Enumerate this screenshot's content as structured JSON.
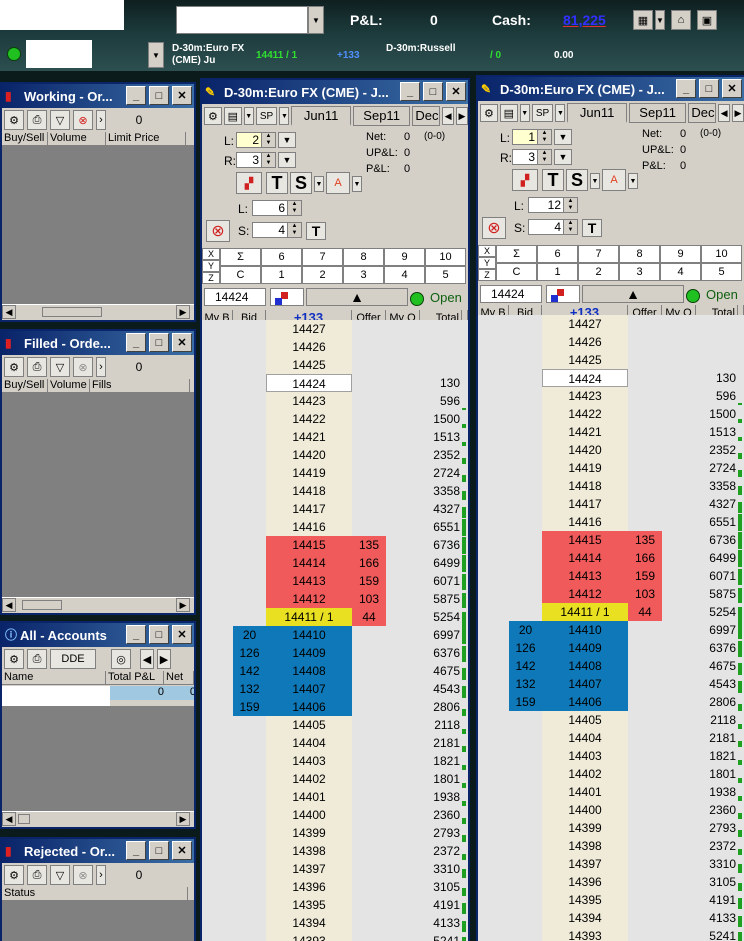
{
  "topbar": {
    "pnl_label": "P&L:",
    "pnl_value": "0",
    "cash_label": "Cash:",
    "cash_value": "81,225",
    "instrument1": "D-30m:Euro FX (CME) Ju",
    "instrument1_price": "14411 / 1",
    "instrument1_change": "+133",
    "instrument2": "D-30m:Russell",
    "instrument2_price": "/ 0",
    "instrument2_value": "0.00"
  },
  "working": {
    "title": "Working - Or...",
    "count": "0",
    "headers": [
      "Buy/Sell",
      "Volume",
      "Limit Price"
    ]
  },
  "filled": {
    "title": "Filled - Orde...",
    "count": "0",
    "headers": [
      "Buy/Sell",
      "Volume",
      "Fills"
    ]
  },
  "accounts": {
    "title": "All - Accounts",
    "dde": "DDE",
    "headers": [
      "Name",
      "Total P&L",
      "Net"
    ],
    "row_values": [
      "0",
      "0"
    ]
  },
  "rejected": {
    "title": "Rejected - Or...",
    "count": "0",
    "headers": [
      "Status"
    ]
  },
  "dom_left": {
    "title": "D-30m:Euro FX (CME) - J...",
    "sp": "SP",
    "tabs": [
      "Jun11",
      "Sep11",
      "Dec"
    ],
    "L_label": "L:",
    "L_value": "2",
    "R_label": "R:",
    "R_value": "3",
    "net_label": "Net:",
    "net_value": "0",
    "net_extra": "(0-0)",
    "upl_label": "UP&L:",
    "upl_value": "0",
    "pl_label": "P&L:",
    "pl_value": "0",
    "L2_label": "L:",
    "L2_value": "6",
    "S_label": "S:",
    "S_value": "4",
    "price_box": "14424",
    "open_label": "Open",
    "change": "+133"
  },
  "dom_right": {
    "title": "D-30m:Euro FX (CME) - J...",
    "sp": "SP",
    "tabs": [
      "Jun11",
      "Sep11",
      "Dec"
    ],
    "L_label": "L:",
    "L_value": "1",
    "R_label": "R:",
    "R_value": "3",
    "net_label": "Net:",
    "net_value": "0",
    "net_extra": "(0-0)",
    "upl_label": "UP&L:",
    "upl_value": "0",
    "pl_label": "P&L:",
    "pl_value": "0",
    "L2_label": "L:",
    "L2_value": "12",
    "S_label": "S:",
    "S_value": "4",
    "price_box": "14424",
    "open_label": "Open",
    "change": "+133"
  },
  "grid_labels": {
    "xyz": [
      "X",
      "Y",
      "Z"
    ],
    "row1": [
      "Σ",
      "6",
      "7",
      "8",
      "9",
      "10"
    ],
    "row2": [
      "C",
      "1",
      "2",
      "3",
      "4",
      "5"
    ],
    "T": "T",
    "S": "S"
  },
  "ladder_headers": [
    "My B",
    "Bid",
    "+133",
    "Offer",
    "My O",
    "Total"
  ],
  "ladder_rows": [
    {
      "price": "14427",
      "bid": "",
      "offer": "",
      "total": "",
      "kind": "plain"
    },
    {
      "price": "14426",
      "bid": "",
      "offer": "",
      "total": "",
      "kind": "plain"
    },
    {
      "price": "14425",
      "bid": "",
      "offer": "",
      "total": "",
      "kind": "plain"
    },
    {
      "price": "14424",
      "bid": "",
      "offer": "",
      "total": "130",
      "kind": "current"
    },
    {
      "price": "14423",
      "bid": "",
      "offer": "",
      "total": "596",
      "kind": "plain"
    },
    {
      "price": "14422",
      "bid": "",
      "offer": "",
      "total": "1500",
      "kind": "plain"
    },
    {
      "price": "14421",
      "bid": "",
      "offer": "",
      "total": "1513",
      "kind": "plain"
    },
    {
      "price": "14420",
      "bid": "",
      "offer": "",
      "total": "2352",
      "kind": "plain"
    },
    {
      "price": "14419",
      "bid": "",
      "offer": "",
      "total": "2724",
      "kind": "plain"
    },
    {
      "price": "14418",
      "bid": "",
      "offer": "",
      "total": "3358",
      "kind": "plain"
    },
    {
      "price": "14417",
      "bid": "",
      "offer": "",
      "total": "4327",
      "kind": "plain"
    },
    {
      "price": "14416",
      "bid": "",
      "offer": "",
      "total": "6551",
      "kind": "plain"
    },
    {
      "price": "14415",
      "bid": "",
      "offer": "135",
      "total": "6736",
      "kind": "ask"
    },
    {
      "price": "14414",
      "bid": "",
      "offer": "166",
      "total": "6499",
      "kind": "ask"
    },
    {
      "price": "14413",
      "bid": "",
      "offer": "159",
      "total": "6071",
      "kind": "ask"
    },
    {
      "price": "14412",
      "bid": "",
      "offer": "103",
      "total": "5875",
      "kind": "ask"
    },
    {
      "price": "14411 / 1",
      "bid": "",
      "offer": "44",
      "total": "5254",
      "kind": "last"
    },
    {
      "price": "14410",
      "bid": "20",
      "offer": "",
      "total": "6997",
      "kind": "bid"
    },
    {
      "price": "14409",
      "bid": "126",
      "offer": "",
      "total": "6376",
      "kind": "bid"
    },
    {
      "price": "14408",
      "bid": "142",
      "offer": "",
      "total": "4675",
      "kind": "bid"
    },
    {
      "price": "14407",
      "bid": "132",
      "offer": "",
      "total": "4543",
      "kind": "bid"
    },
    {
      "price": "14406",
      "bid": "159",
      "offer": "",
      "total": "2806",
      "kind": "bid"
    },
    {
      "price": "14405",
      "bid": "",
      "offer": "",
      "total": "2118",
      "kind": "plain"
    },
    {
      "price": "14404",
      "bid": "",
      "offer": "",
      "total": "2181",
      "kind": "plain"
    },
    {
      "price": "14403",
      "bid": "",
      "offer": "",
      "total": "1821",
      "kind": "plain"
    },
    {
      "price": "14402",
      "bid": "",
      "offer": "",
      "total": "1801",
      "kind": "plain"
    },
    {
      "price": "14401",
      "bid": "",
      "offer": "",
      "total": "1938",
      "kind": "plain"
    },
    {
      "price": "14400",
      "bid": "",
      "offer": "",
      "total": "2360",
      "kind": "plain"
    },
    {
      "price": "14399",
      "bid": "",
      "offer": "",
      "total": "2793",
      "kind": "plain"
    },
    {
      "price": "14398",
      "bid": "",
      "offer": "",
      "total": "2372",
      "kind": "plain"
    },
    {
      "price": "14397",
      "bid": "",
      "offer": "",
      "total": "3310",
      "kind": "plain"
    },
    {
      "price": "14396",
      "bid": "",
      "offer": "",
      "total": "3105",
      "kind": "plain"
    },
    {
      "price": "14395",
      "bid": "",
      "offer": "",
      "total": "4191",
      "kind": "plain"
    },
    {
      "price": "14394",
      "bid": "",
      "offer": "",
      "total": "4133",
      "kind": "plain"
    },
    {
      "price": "14393",
      "bid": "",
      "offer": "",
      "total": "5241",
      "kind": "plain"
    }
  ],
  "colors": {
    "ask": "#f05a5a",
    "last": "#e8e020",
    "bid": "#0e78b8",
    "current_bg": "#ffffff",
    "volume_bar": "#20a020",
    "title_bar": "#0a246a"
  }
}
